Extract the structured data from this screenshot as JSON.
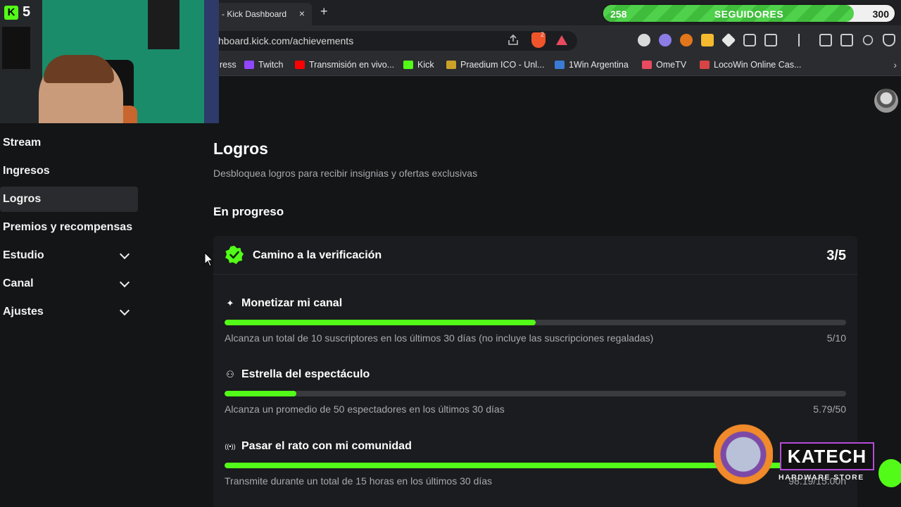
{
  "browser": {
    "tab_title": "- Kick Dashboard",
    "tab_close": "×",
    "new_tab": "+",
    "url": "hboard.kick.com/achievements",
    "brave_badge_count": "2",
    "bookmarks": [
      {
        "label": "ress",
        "icon_color": "#2b2c30"
      },
      {
        "label": "Twitch",
        "icon_color": "#9146ff"
      },
      {
        "label": "Transmisión en vivo...",
        "icon_color": "#ff0000"
      },
      {
        "label": "Kick",
        "icon_color": "#53fc18"
      },
      {
        "label": "Praedium ICO - Unl...",
        "icon_color": "#c9a227"
      },
      {
        "label": "1Win Argentina",
        "icon_color": "#3a7bd5"
      },
      {
        "label": "OmeTV",
        "icon_color": "#e84a5f"
      },
      {
        "label": "LocoWin Online Cas...",
        "icon_color": "#d64545"
      }
    ],
    "bookmarks_more": "›"
  },
  "follower_goal": {
    "current": "258",
    "label": "SEGUIDORES",
    "target": "300",
    "progress": 0.86
  },
  "stream_overlay": {
    "viewer_count": "5",
    "kick_logo": "K"
  },
  "sidebar": {
    "items": [
      {
        "label": "Stream",
        "active": false,
        "expandable": false
      },
      {
        "label": "Ingresos",
        "active": false,
        "expandable": false
      },
      {
        "label": "Logros",
        "active": true,
        "expandable": false
      },
      {
        "label": "Premios y recompensas",
        "active": false,
        "expandable": false
      },
      {
        "label": "Estudio",
        "active": false,
        "expandable": true
      },
      {
        "label": "Canal",
        "active": false,
        "expandable": true
      },
      {
        "label": "Ajustes",
        "active": false,
        "expandable": true
      }
    ]
  },
  "main": {
    "title": "Logros",
    "subtitle": "Desbloquea logros para recibir insignias y ofertas exclusivas",
    "section": "En progreso",
    "card": {
      "title": "Camino a la verificación",
      "count": "3/5",
      "achievements": [
        {
          "icon": "sparkle-icon",
          "glyph": "✦",
          "title": "Monetizar mi canal",
          "desc": "Alcanza un total de 10 suscriptores en los últimos 30 días (no incluye las suscripciones regaladas)",
          "value": "5/10",
          "progress": 0.5
        },
        {
          "icon": "people-icon",
          "glyph": "⚇",
          "title": "Estrella del espectáculo",
          "desc": "Alcanza un promedio de 50 espectadores en los últimos 30 días",
          "value": "5.79/50",
          "progress": 0.1158
        },
        {
          "icon": "broadcast-icon",
          "glyph": "((•))",
          "title": "Pasar el rato con mi comunidad",
          "desc": "Transmite durante un total de 15 horas en los últimos 30 días",
          "value": "98.19/15.00h",
          "progress": 1.0
        }
      ]
    }
  },
  "sponsor": {
    "brand": "KATECH",
    "tagline": "HARDWARE STORE"
  },
  "colors": {
    "kick_green": "#53fc18",
    "bg": "#141517",
    "card_bg": "#1b1c1f"
  }
}
